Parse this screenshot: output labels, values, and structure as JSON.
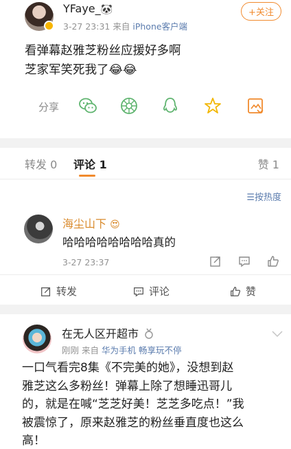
{
  "post": {
    "username": "YFaye_",
    "username_emoji": "🐼",
    "time": "3-27 23:31",
    "source_prefix": "来自",
    "source": "iPhone客户端",
    "follow_label": "+关注",
    "text_line1": "看弹幕赵雅芝粉丝应援好多啊",
    "text_line2": "芝家军笑死我了😂😂"
  },
  "share": {
    "label": "分享",
    "icons": [
      "wechat-icon",
      "moments-icon",
      "qq-icon",
      "qzone-star-icon",
      "save-image-icon"
    ]
  },
  "tabs": {
    "repost": "转发 0",
    "comment": "评论 1",
    "like": "赞 1"
  },
  "sort_label": "☰按热度",
  "comment": {
    "username": "海尘山下",
    "username_emoji": "😍",
    "text": "哈哈哈哈哈哈哈哈真的",
    "time": "3-27 23:37"
  },
  "actions": {
    "repost": "转发",
    "comment": "评论",
    "like": "赞"
  },
  "post2": {
    "username": "在无人区开超市",
    "time": "刚刚",
    "source_prefix": "来自",
    "source": "华为手机 畅享玩不停",
    "text_line1": "一口气看完8集《不完美的她》，没想到赵",
    "text_line2": "雅芝这么多粉丝！弹幕上除了想睡迅哥儿",
    "text_line3": "的，就是在喊“芝芝好美！芝芝多吃点！”我",
    "text_line4": "被震惊了，原来赵雅芝的粉丝垂直度也这么",
    "text_line5": "高！"
  },
  "colors": {
    "accent": "#f18a2d",
    "link": "#5b7cae",
    "share_icon": "#5fb46f",
    "star_icon": "#f2b705"
  }
}
